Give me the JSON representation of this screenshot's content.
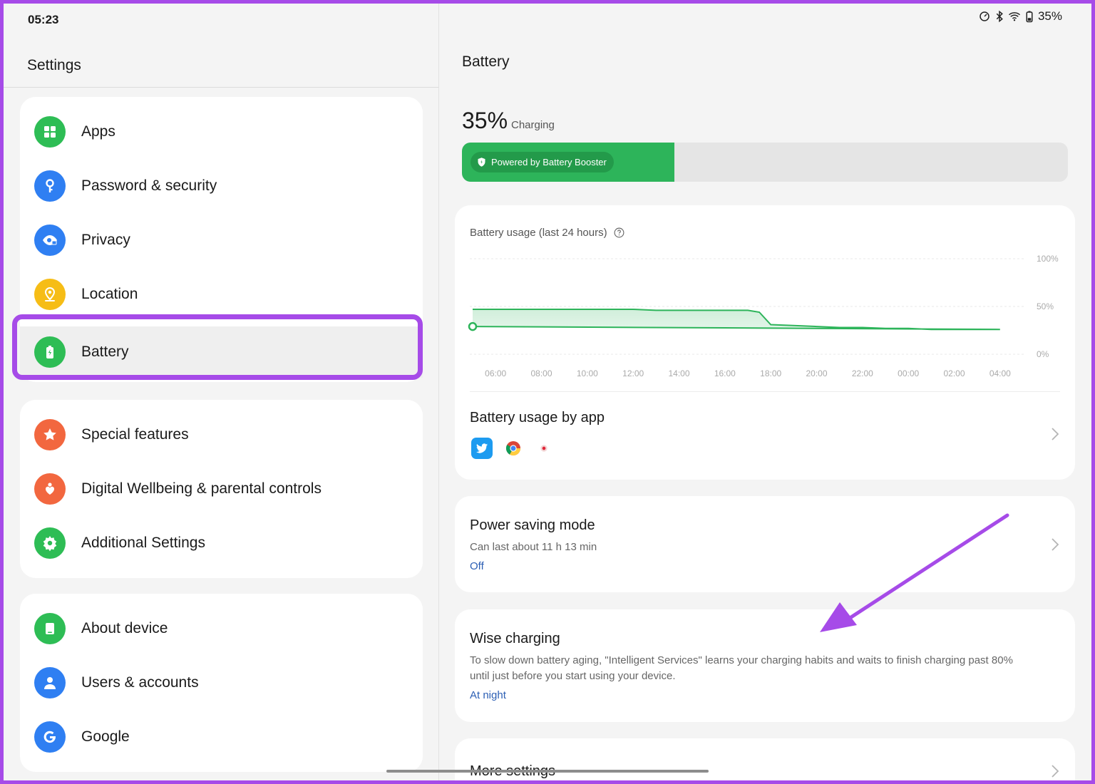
{
  "status_bar": {
    "time": "05:23",
    "battery_text": "35%",
    "icons": [
      "data-saver-icon",
      "bluetooth-icon",
      "wifi-icon",
      "battery-charging-icon"
    ]
  },
  "left_pane": {
    "title": "Settings",
    "groups": [
      {
        "items": [
          {
            "label": "Apps",
            "icon": "apps-grid-icon",
            "color": "#2ebd55"
          },
          {
            "label": "Password & security",
            "icon": "key-icon",
            "color": "#2f7ff2"
          },
          {
            "label": "Privacy",
            "icon": "eye-lock-icon",
            "color": "#2f7ff2"
          },
          {
            "label": "Location",
            "icon": "location-pin-icon",
            "color": "#f6bd16"
          },
          {
            "label": "Battery",
            "icon": "battery-icon",
            "color": "#2ebd55",
            "selected": true
          }
        ]
      },
      {
        "items": [
          {
            "label": "Special features",
            "icon": "star-icon",
            "color": "#f2673f"
          },
          {
            "label": "Digital Wellbeing & parental controls",
            "icon": "heart-person-icon",
            "color": "#f2673f"
          },
          {
            "label": "Additional Settings",
            "icon": "gear-icon",
            "color": "#2ebd55"
          }
        ]
      },
      {
        "items": [
          {
            "label": "About device",
            "icon": "tablet-icon",
            "color": "#2ebd55"
          },
          {
            "label": "Users & accounts",
            "icon": "person-icon",
            "color": "#2f7ff2"
          },
          {
            "label": "Google",
            "icon": "google-g-icon",
            "color": "#2f7ff2"
          }
        ]
      }
    ]
  },
  "battery": {
    "title": "Battery",
    "percent": "35%",
    "state": "Charging",
    "level": 0.35,
    "booster_label": "Powered by Battery Booster",
    "colors": {
      "fill": "#2db45a",
      "badge": "#239a4a",
      "accent_link": "#2c5fb4"
    }
  },
  "chart_data": {
    "type": "area",
    "title": "Battery usage (last 24 hours)",
    "x": [
      "05:00",
      "06:00",
      "07:00",
      "08:00",
      "09:00",
      "10:00",
      "11:00",
      "12:00",
      "13:00",
      "14:00",
      "15:00",
      "16:00",
      "17:00",
      "17:30",
      "18:00",
      "19:00",
      "20:00",
      "21:00",
      "22:00",
      "23:00",
      "00:00",
      "01:00",
      "02:00",
      "03:00",
      "04:00",
      "05:00"
    ],
    "series": [
      {
        "values": [
          47,
          47,
          47,
          47,
          47,
          47,
          47,
          47,
          46,
          46,
          46,
          46,
          46,
          44,
          31,
          30,
          29,
          28,
          28,
          27,
          27,
          26,
          26,
          26,
          26,
          29
        ]
      }
    ],
    "xticks": [
      "06:00",
      "08:00",
      "10:00",
      "12:00",
      "14:00",
      "16:00",
      "18:00",
      "20:00",
      "22:00",
      "00:00",
      "02:00",
      "04:00"
    ],
    "yticks": [
      "100%",
      "50%",
      "0%"
    ],
    "ylim": [
      0,
      100
    ],
    "grid": true
  },
  "usage_by_app": {
    "title": "Battery usage by app",
    "apps": [
      "twitter-icon",
      "chrome-icon",
      "screen-recorder-icon"
    ]
  },
  "power_saving": {
    "title": "Power saving mode",
    "subtitle": "Can last about 11 h 13 min",
    "status": "Off"
  },
  "wise_charging": {
    "title": "Wise charging",
    "description_line1": "To slow down battery aging, \"Intelligent Services\" learns your charging habits and waits to finish charging past 80%",
    "description_line2": "until just before you start using your device.",
    "status": "At night"
  },
  "more_settings": {
    "title": "More settings"
  },
  "annotation": {
    "highlight_color": "#a64be8"
  }
}
